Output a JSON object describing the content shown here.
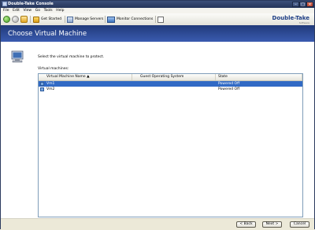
{
  "window": {
    "title": "Double-Take Console"
  },
  "menu": [
    {
      "label": "File"
    },
    {
      "label": "Edit"
    },
    {
      "label": "View"
    },
    {
      "label": "Go"
    },
    {
      "label": "Tools"
    },
    {
      "label": "Help"
    }
  ],
  "toolbar": {
    "get_started": "Get Started",
    "manage_servers": "Manage Servers",
    "monitor_connections": "Monitor Connections"
  },
  "brand": {
    "logo": "Double-Take",
    "sub": "Software"
  },
  "header": {
    "title": "Choose Virtual Machine"
  },
  "instructions": "Select the virtual machine to protect.",
  "vm_list": {
    "label": "Virtual machines:",
    "columns": [
      "Virtual Machine Name",
      "Guest Operating System",
      "State"
    ],
    "rows": [
      {
        "name": "Vm1",
        "os": "",
        "state": "Powered Off",
        "selected": true
      },
      {
        "name": "Vm2",
        "os": "",
        "state": "Powered Off",
        "selected": false
      }
    ]
  },
  "buttons": {
    "back": "< Back",
    "next": "Next >",
    "cancel": "Cancel"
  },
  "colors": {
    "header": "#2c4a96",
    "selection": "#316ac5"
  }
}
